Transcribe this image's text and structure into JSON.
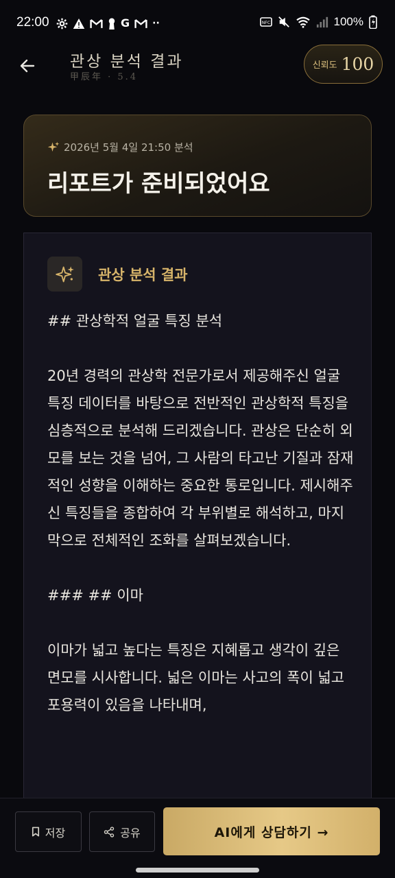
{
  "status_bar": {
    "time": "22:00",
    "left_icons": [
      "settings-icon",
      "alert-icon",
      "gmail-icon",
      "keyhole-icon",
      "google-icon",
      "gmail-icon",
      "more-icon"
    ],
    "battery": "100%"
  },
  "header": {
    "title": "관상 분석 결과",
    "subtitle": "甲辰年 · 5.4",
    "trust_label": "신뢰도",
    "trust_value": "100"
  },
  "ready_card": {
    "date_text": "2026년 5월 4일 21:50 분석",
    "title": "리포트가 준비되었어요"
  },
  "report": {
    "heading": "관상 분석 결과",
    "paragraphs": [
      "## 관상학적 얼굴 특징 분석",
      "20년 경력의 관상학 전문가로서 제공해주신 얼굴 특징 데이터를 바탕으로 전반적인 관상학적 특징을 심층적으로 분석해 드리겠습니다. 관상은 단순히 외모를 보는 것을 넘어, 그 사람의 타고난 기질과 잠재적인 성향을 이해하는 중요한 통로입니다. 제시해주신 특징들을 종합하여 각 부위별로 해석하고, 마지막으로 전체적인 조화를 살펴보겠습니다.",
      "### ## 이마",
      "이마가 넓고 높다는 특징은 지혜롭고 생각이 깊은 면모를 시사합니다. 넓은 이마는 사고의 폭이 넓고 포용력이 있음을 나타내며,"
    ]
  },
  "bottom_bar": {
    "save_label": "저장",
    "share_label": "공유",
    "ai_label": "AI에게 상담하기 →"
  },
  "colors": {
    "background": "#09090d",
    "accent_gold": "#d7b46a",
    "panel": "#14131d"
  }
}
